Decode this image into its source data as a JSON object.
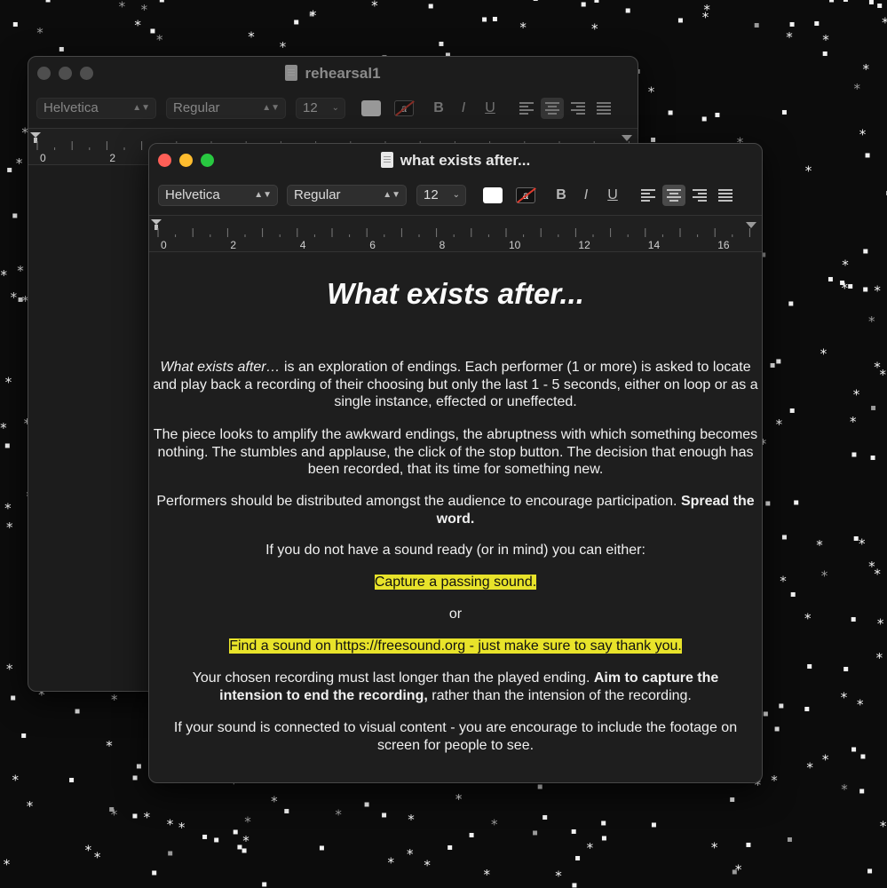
{
  "back_window": {
    "title": "rehearsal1",
    "toolbar": {
      "font": "Helvetica",
      "style": "Regular",
      "size": "12",
      "bold": "B",
      "italic": "I",
      "underline": "U"
    },
    "ruler_labels": [
      "0",
      "2"
    ]
  },
  "front_window": {
    "title": "what exists after...",
    "toolbar": {
      "font": "Helvetica",
      "style": "Regular",
      "size": "12",
      "bold": "B",
      "italic": "I",
      "underline": "U"
    },
    "ruler_labels": [
      "0",
      "2",
      "4",
      "6",
      "8",
      "10",
      "12",
      "14",
      "16"
    ],
    "document": {
      "heading": "What exists after...",
      "p1_italic": "What exists after…",
      "p1_rest": " is an exploration of endings. Each performer (1 or more) is asked to locate and play back a recording of their choosing but only the last 1 - 5 seconds, either on loop or as a single instance, effected or uneffected.",
      "p2": "The piece looks to amplify the awkward endings, the abruptness with which something becomes nothing. The stumbles and applause, the click of the stop button. The decision that enough has been recorded, that its time for something new.",
      "p3_plain": "Performers should be distributed amongst the audience to encourage participation. ",
      "p3_bold": "Spread the word.",
      "p4": "If you do not have a sound ready (or in mind) you can either:",
      "p5_highlight": "Capture a passing sound.",
      "p6": "or",
      "p7_highlight": "Find a sound on https://freesound.org - just make sure to say thank you.",
      "p8_plain": "Your chosen recording must last longer than the played ending. ",
      "p8_bold": "Aim to capture the intension to end the recording,",
      "p8_rest": " rather than the intension of the recording.",
      "p9": "If your sound is connected to visual content - you are encourage to include the footage on screen for people to see."
    }
  },
  "colors": {
    "close": "#fe5f57",
    "minimize": "#febc2e",
    "zoom": "#28c840",
    "inactive_light": "#5a5a5a",
    "highlight": "#e8e32a"
  }
}
